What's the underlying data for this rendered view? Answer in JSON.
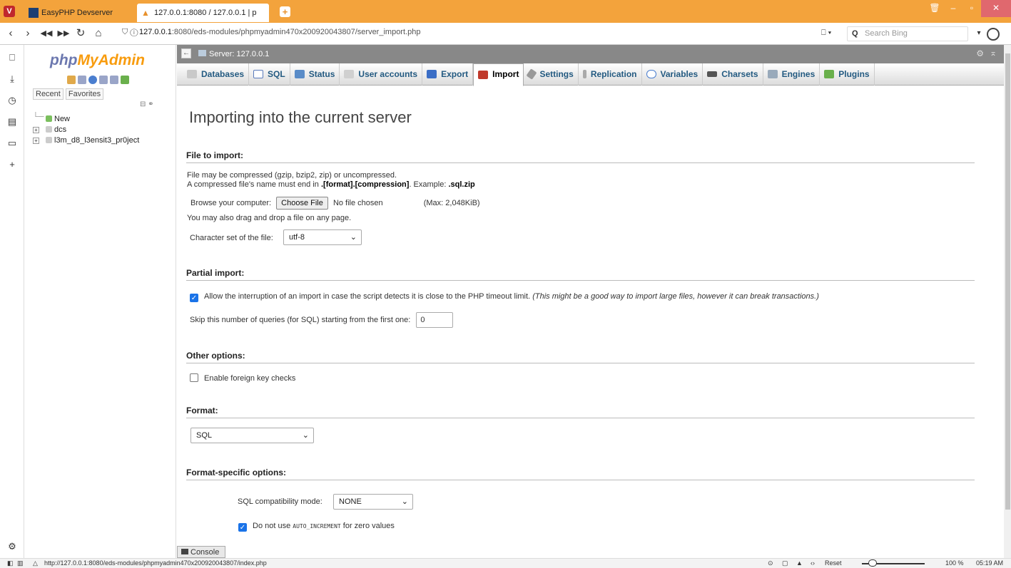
{
  "browser": {
    "tabs": [
      {
        "label": "EasyPHP Devserver"
      },
      {
        "label": "127.0.0.1:8080 / 127.0.0.1 | p"
      }
    ],
    "new_tab": "+",
    "address": {
      "host": "127.0.0.1",
      "path": ":8080/eds-modules/phpmyadmin470x200920043807/server_import.php"
    },
    "search_placeholder": "Search Bing",
    "status_url": "http://127.0.0.1:8080/eds-modules/phpmyadmin470x200920043807/index.php",
    "zoom_reset": "Reset",
    "zoom": "100 %",
    "time": "05:19 AM"
  },
  "pma": {
    "logo_php": "php",
    "logo_myadmin": "MyAdmin",
    "recent": "Recent",
    "favorites": "Favorites",
    "tree": [
      {
        "label": "New",
        "type": "new"
      },
      {
        "label": "dcs",
        "type": "db"
      },
      {
        "label": "l3m_d8_l3ensit3_pr0ject",
        "type": "db"
      }
    ],
    "server_breadcrumb": "Server: 127.0.0.1",
    "menu": [
      {
        "label": "Databases",
        "icon": "database-icon",
        "active": false
      },
      {
        "label": "SQL",
        "icon": "sql-icon",
        "active": false
      },
      {
        "label": "Status",
        "icon": "status-icon",
        "active": false
      },
      {
        "label": "User accounts",
        "icon": "users-icon",
        "active": false
      },
      {
        "label": "Export",
        "icon": "export-icon",
        "active": false
      },
      {
        "label": "Import",
        "icon": "import-icon",
        "active": true
      },
      {
        "label": "Settings",
        "icon": "wrench-icon",
        "active": false
      },
      {
        "label": "Replication",
        "icon": "replication-icon",
        "active": false
      },
      {
        "label": "Variables",
        "icon": "variables-icon",
        "active": false
      },
      {
        "label": "Charsets",
        "icon": "charsets-icon",
        "active": false
      },
      {
        "label": "Engines",
        "icon": "engines-icon",
        "active": false
      },
      {
        "label": "Plugins",
        "icon": "plugins-icon",
        "active": false
      }
    ],
    "page_title": "Importing into the current server",
    "file_section": {
      "heading": "File to import:",
      "line1": "File may be compressed (gzip, bzip2, zip) or uncompressed.",
      "line2_pre": "A compressed file's name must end in ",
      "line2_fmt": ".[format].[compression]",
      "line2_mid": ". Example: ",
      "line2_ex": ".sql.zip",
      "browse_label": "Browse your computer:",
      "choose_button": "Choose File",
      "no_file": "No file chosen",
      "max": "(Max: 2,048KiB)",
      "drag_hint": "You may also drag and drop a file on any page.",
      "charset_label": "Character set of the file:",
      "charset_value": "utf-8"
    },
    "partial_section": {
      "heading": "Partial import:",
      "allow_interrupt": "Allow the interruption of an import in case the script detects it is close to the PHP timeout limit.",
      "allow_interrupt_note": "(This might be a good way to import large files, however it can break transactions.)",
      "allow_interrupt_checked": true,
      "skip_label": "Skip this number of queries (for SQL) starting from the first one:",
      "skip_value": "0"
    },
    "other_section": {
      "heading": "Other options:",
      "fk_label": "Enable foreign key checks",
      "fk_checked": false
    },
    "format_section": {
      "heading": "Format:",
      "value": "SQL"
    },
    "format_specific": {
      "heading": "Format-specific options:",
      "compat_label": "SQL compatibility mode:",
      "compat_value": "NONE",
      "auto_inc_pre": "Do not use",
      "auto_inc_code": "AUTO_INCREMENT",
      "auto_inc_post": "for zero values",
      "auto_inc_checked": true
    },
    "console": "Console"
  },
  "colors": {
    "tabbar": "#f3a33c",
    "link_blue": "#235a81",
    "checkbox_blue": "#1a73e8"
  }
}
